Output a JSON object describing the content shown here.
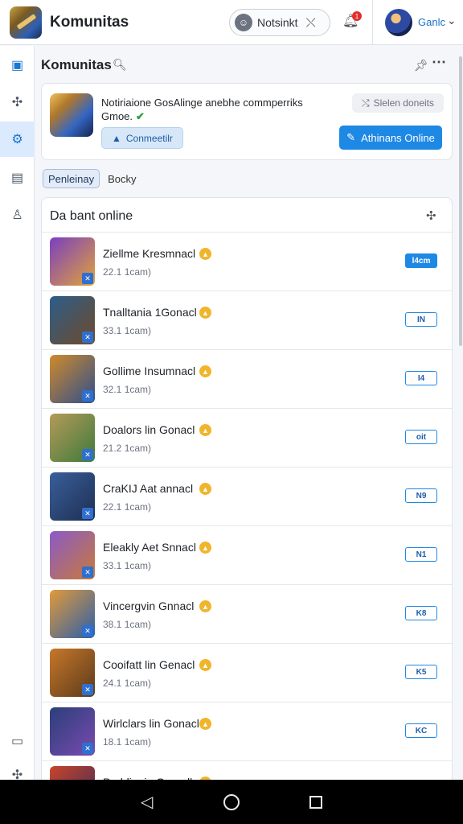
{
  "header": {
    "app_title": "Komunitas",
    "search_label": "Notsinkt",
    "notification_count": "1",
    "user_name": "Ganlc"
  },
  "rail": {
    "items": [
      {
        "icon": "briefcase-icon",
        "active": false
      },
      {
        "icon": "puzzle-icon",
        "active": false
      },
      {
        "icon": "gear-icon",
        "active": true
      },
      {
        "icon": "chat-icon",
        "active": false
      },
      {
        "icon": "user-outline-icon",
        "active": false
      }
    ],
    "bottom_items": [
      {
        "icon": "folder-icon"
      },
      {
        "icon": "puzzle-icon"
      }
    ]
  },
  "main": {
    "title": "Komunitas"
  },
  "notice": {
    "text": "Notiriaione GosAlinge anebhe commperriks",
    "subtext": "Gmoe.",
    "status_label": "Slelen doneits",
    "connect_label": "Conmeetilr",
    "online_label": "Athinans Online"
  },
  "tabs": [
    {
      "label": "Penleinay",
      "active": true
    },
    {
      "label": "Bocky",
      "active": false
    }
  ],
  "list": {
    "title": "Da bant online",
    "rows": [
      {
        "name": "Ziellme Kresmnacl",
        "meta": "22.1 1cam)",
        "tag": "l4cm",
        "filled": true,
        "c1": "#7a3fc0",
        "c2": "#e2a23a"
      },
      {
        "name": "Tnalltania 1Gonacl",
        "meta": "33.1 1cam)",
        "tag": "IN",
        "filled": false,
        "c1": "#2c5d8a",
        "c2": "#6f4a2a"
      },
      {
        "name": "Gollime Insumnacl",
        "meta": "32.1 1cam)",
        "tag": "I4",
        "filled": false,
        "c1": "#d08a2a",
        "c2": "#2e4f8c"
      },
      {
        "name": "Doalors lin Gonacl",
        "meta": "21.2 1cam)",
        "tag": "oit",
        "filled": false,
        "c1": "#b59a5a",
        "c2": "#3e7a3a"
      },
      {
        "name": "CraKIJ Aat annacl",
        "meta": "22.1 1cam)",
        "tag": "N9",
        "filled": false,
        "c1": "#3a5f9a",
        "c2": "#1d2f52"
      },
      {
        "name": "Eleakly Aet Snnacl",
        "meta": "33.1 1cam)",
        "tag": "N1",
        "filled": false,
        "c1": "#8a5ac8",
        "c2": "#c87a3a"
      },
      {
        "name": "Vincergvin Gnnacl",
        "meta": "38.1 1cam)",
        "tag": "K8",
        "filled": false,
        "c1": "#e29a3a",
        "c2": "#2b5fa8"
      },
      {
        "name": "Cooifatt lin Genacl",
        "meta": "24.1 1cam)",
        "tag": "K5",
        "filled": false,
        "c1": "#c8782a",
        "c2": "#5a3a1a"
      },
      {
        "name": "Wirlclars lin Gonacl",
        "meta": "18.1 1cam)",
        "tag": "KC",
        "filled": false,
        "c1": "#2a3f7a",
        "c2": "#7a4ab0"
      },
      {
        "name": "Porhliania Gonadl",
        "meta": "",
        "tag": "",
        "filled": false,
        "c1": "#c8452a",
        "c2": "#3a2a5a"
      }
    ]
  },
  "colors": {
    "accent": "#1e88e5",
    "badge": "#f1b52c"
  }
}
